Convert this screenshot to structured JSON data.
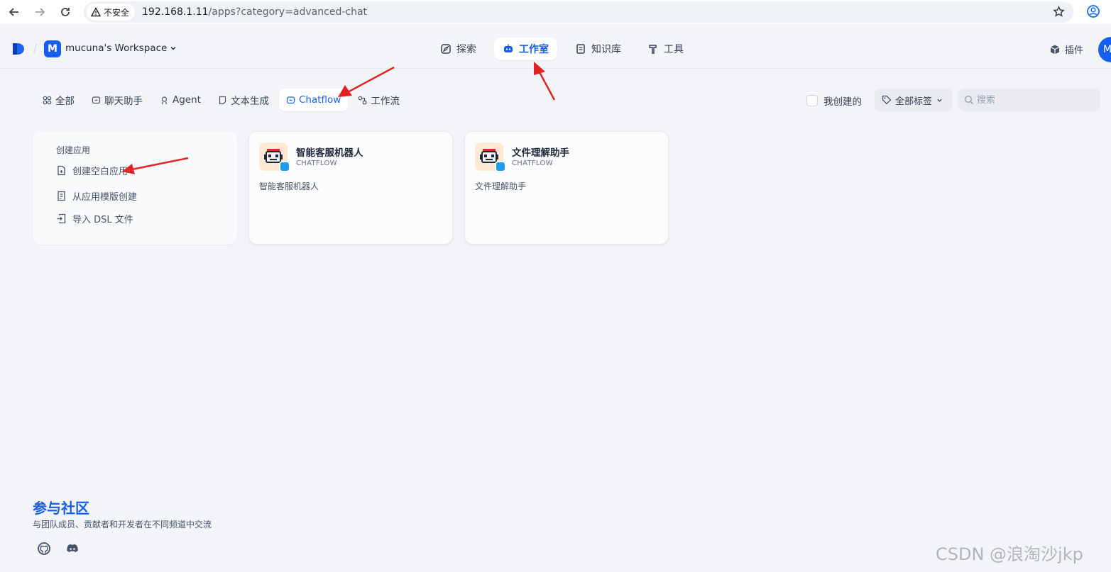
{
  "browser": {
    "security_label": "不安全",
    "url_host": "192.168.1.11",
    "url_path": "/apps?category=advanced-chat"
  },
  "header": {
    "workspace_initial": "M",
    "workspace_name": "mucuna's Workspace",
    "nav": [
      {
        "label": "探索",
        "icon": "compass-icon",
        "active": false
      },
      {
        "label": "工作室",
        "icon": "robot-icon",
        "active": true
      },
      {
        "label": "知识库",
        "icon": "book-icon",
        "active": false
      },
      {
        "label": "工具",
        "icon": "hammer-icon",
        "active": false
      }
    ],
    "plugins_label": "插件",
    "user_initial": "M"
  },
  "filters": {
    "tabs": [
      {
        "label": "全部",
        "icon": "grid-icon",
        "active": false
      },
      {
        "label": "聊天助手",
        "icon": "chat-icon",
        "active": false
      },
      {
        "label": "Agent",
        "icon": "agent-icon",
        "active": false
      },
      {
        "label": "文本生成",
        "icon": "document-icon",
        "active": false
      },
      {
        "label": "Chatflow",
        "icon": "chatflow-icon",
        "active": true
      },
      {
        "label": "工作流",
        "icon": "workflow-icon",
        "active": false
      }
    ],
    "mine_label": "我创建的",
    "tags_label": "全部标签",
    "search_placeholder": "搜索"
  },
  "create": {
    "title": "创建应用",
    "items": [
      "创建空白应用",
      "从应用模版创建",
      "导入 DSL 文件"
    ]
  },
  "apps": [
    {
      "name": "智能客服机器人",
      "type": "CHATFLOW",
      "description": "智能客服机器人"
    },
    {
      "name": "文件理解助手",
      "type": "CHATFLOW",
      "description": "文件理解助手"
    }
  ],
  "footer": {
    "title": "参与社区",
    "subtitle": "与团队成员、贡献者和开发者在不同频道中交流"
  },
  "watermark": "CSDN @浪淘沙jkp",
  "colors": {
    "accent": "#155eef",
    "annotation": "#e02424"
  }
}
